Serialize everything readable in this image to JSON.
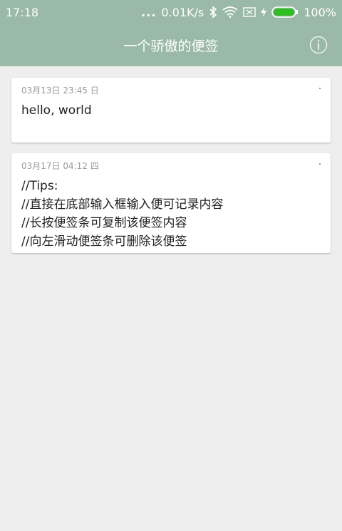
{
  "status_bar": {
    "time": "17:18",
    "dots": "...",
    "network_speed": "0.01K/s",
    "battery_percent": "100%",
    "battery_level": 1.0,
    "icons": [
      "bluetooth-icon",
      "wifi-icon",
      "sim-icon",
      "charging-icon",
      "battery-icon"
    ]
  },
  "app_bar": {
    "title": "一个骄傲的便签",
    "info_icon": "info-icon",
    "color": "#9ab9a6"
  },
  "notes": [
    {
      "date": "03月13日 23:45 日",
      "content": "hello, world"
    },
    {
      "date": "03月17日 04:12 四",
      "content": "//Tips:\n//直接在底部输入框输入便可记录内容\n//长按便签条可复制该便签内容\n//向左滑动便签条可删除该便签"
    }
  ]
}
